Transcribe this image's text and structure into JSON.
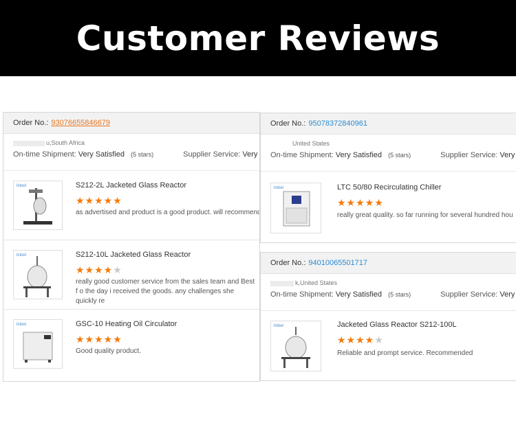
{
  "banner": {
    "title": "Customer Reviews"
  },
  "left": {
    "order_label": "Order No.:",
    "order_number": "93076655846679",
    "location": "u,South Africa",
    "shipment_label": "On-time Shipment:",
    "shipment_value": "Very Satisfied",
    "shipment_stars": "(5 stars)",
    "service_label": "Supplier Service:",
    "service_value": "Very Satisfied",
    "items": [
      {
        "brand": "linbel",
        "title": "S212-2L Jacketed Glass Reactor",
        "rating": 5,
        "comment": "as advertised and product is a good product. will recommend"
      },
      {
        "brand": "linbel",
        "title": "S212-10L Jacketed Glass Reactor",
        "rating": 4,
        "comment": "really good customer service from the sales team and Best f o the day i received the goods. any challenges she quickly re"
      },
      {
        "brand": "linbel",
        "title": "GSC-10 Heating Oil Circulator",
        "rating": 5,
        "comment": "Good quality product."
      }
    ]
  },
  "right1": {
    "order_label": "Order No.:",
    "order_number": "95078372840961",
    "location": "United States",
    "shipment_label": "On-time Shipment:",
    "shipment_value": "Very Satisfied",
    "shipment_stars": "(5 stars)",
    "service_label": "Supplier Service:",
    "service_value": "Very Satisfie",
    "items": [
      {
        "brand": "linbel",
        "title": "LTC 50/80 Recirculating Chiller",
        "rating": 5,
        "comment": "really great quality.  so far running for several hundred hou"
      }
    ]
  },
  "right2": {
    "order_label": "Order No.:",
    "order_number": "94010065501717",
    "location": "k,United States",
    "shipment_label": "On-time Shipment:",
    "shipment_value": "Very Satisfied",
    "shipment_stars": "(5 stars)",
    "service_label": "Supplier Service:",
    "service_value": "Very Satisfie",
    "items": [
      {
        "brand": "linbel",
        "title": "Jacketed Glass Reactor S212-100L",
        "rating": 4,
        "comment": "Reliable and prompt service. Recommended"
      }
    ]
  },
  "colors": {
    "star_on": "#f57a0a",
    "star_off": "#c8c8c8",
    "order_link_blue": "#2b8bd1",
    "order_link_orange": "#e87722"
  }
}
